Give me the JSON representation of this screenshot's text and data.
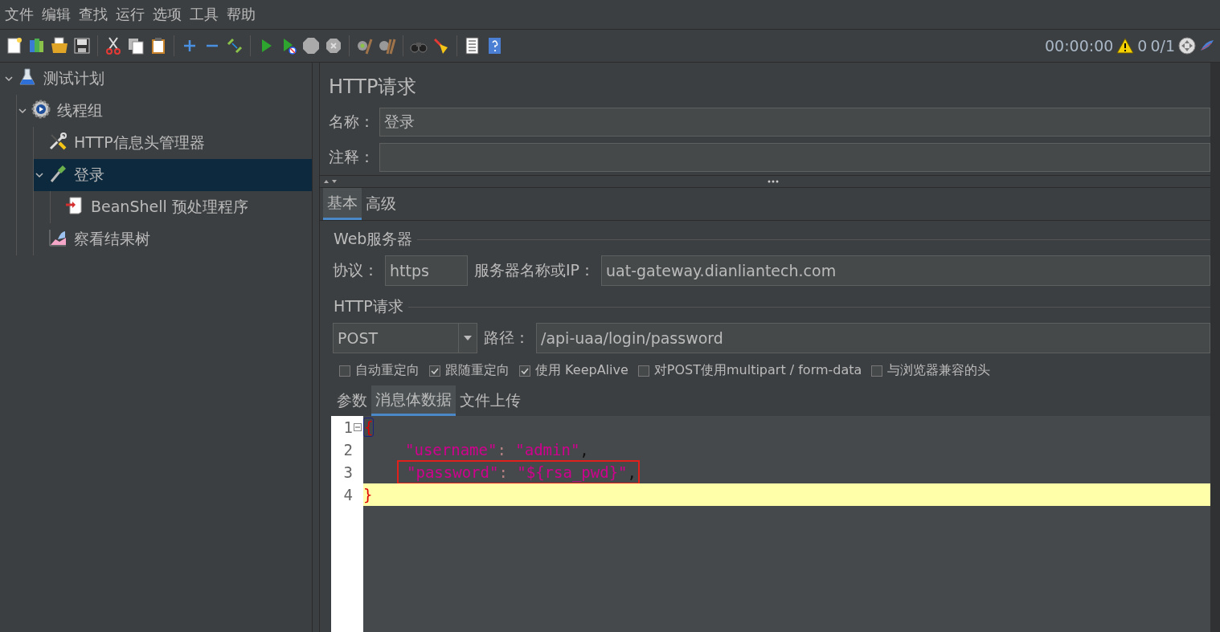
{
  "menu": [
    "文件",
    "编辑",
    "查找",
    "运行",
    "选项",
    "工具",
    "帮助"
  ],
  "status": {
    "timer": "00:00:00",
    "warnings": "0",
    "threads": "0/1"
  },
  "tree": [
    {
      "label": "测试计划",
      "kind": "plan",
      "expanded": true,
      "selected": false,
      "children": [
        {
          "label": "线程组",
          "kind": "threads",
          "expanded": true,
          "selected": false,
          "children": [
            {
              "label": "HTTP信息头管理器",
              "kind": "config",
              "selected": false
            },
            {
              "label": "登录",
              "kind": "sampler",
              "expanded": true,
              "selected": true,
              "children": [
                {
                  "label": "BeanShell 预处理程序",
                  "kind": "preprocessor",
                  "selected": false
                }
              ]
            },
            {
              "label": "察看结果树",
              "kind": "listener",
              "selected": false
            }
          ]
        }
      ]
    }
  ],
  "panel": {
    "title": "HTTP请求",
    "name_label": "名称：",
    "name": "登录",
    "comment_label": "注释：",
    "tabs": [
      {
        "label": "基本",
        "selected": true
      },
      {
        "label": "高级",
        "selected": false
      }
    ],
    "web_server": {
      "legend": "Web服务器",
      "protocol_label": "协议：",
      "protocol": "https",
      "server_label": "服务器名称或IP：",
      "server": "uat-gateway.dianliantech.com"
    },
    "http_request": {
      "legend": "HTTP请求",
      "method": "POST",
      "path_label": "路径：",
      "path": "/api-uaa/login/password"
    },
    "options": [
      {
        "label": "自动重定向",
        "checked": false
      },
      {
        "label": "跟随重定向",
        "checked": true
      },
      {
        "label": "使用 KeepAlive",
        "checked": true
      },
      {
        "label": "对POST使用multipart / form-data",
        "checked": false
      },
      {
        "label": "与浏览器兼容的头",
        "checked": false
      }
    ],
    "body_tabs": [
      {
        "label": "参数",
        "selected": false
      },
      {
        "label": "消息体数据",
        "selected": true
      },
      {
        "label": "文件上传",
        "selected": false
      }
    ],
    "code": [
      {
        "number": "1",
        "foldable": true,
        "current": false,
        "boxed": false,
        "indented": false,
        "tokens": [
          {
            "kind": "brace",
            "text": "{"
          }
        ]
      },
      {
        "number": "2",
        "foldable": false,
        "current": false,
        "boxed": false,
        "indented": true,
        "tokens": [
          {
            "kind": "string",
            "text": "\"username\""
          },
          {
            "kind": "colon",
            "text": ": "
          },
          {
            "kind": "string",
            "text": "\"admin\""
          },
          {
            "kind": "punct",
            "text": ","
          }
        ]
      },
      {
        "number": "3",
        "foldable": false,
        "current": false,
        "boxed": true,
        "indented": true,
        "tokens": [
          {
            "kind": "string",
            "text": "\"password\""
          },
          {
            "kind": "colon",
            "text": ": "
          },
          {
            "kind": "string",
            "text": "\"${rsa_pwd}\""
          },
          {
            "kind": "punct",
            "text": ","
          }
        ]
      },
      {
        "number": "4",
        "foldable": false,
        "current": true,
        "boxed": false,
        "indented": false,
        "tokens": [
          {
            "kind": "brace",
            "text": "}"
          }
        ]
      }
    ]
  }
}
